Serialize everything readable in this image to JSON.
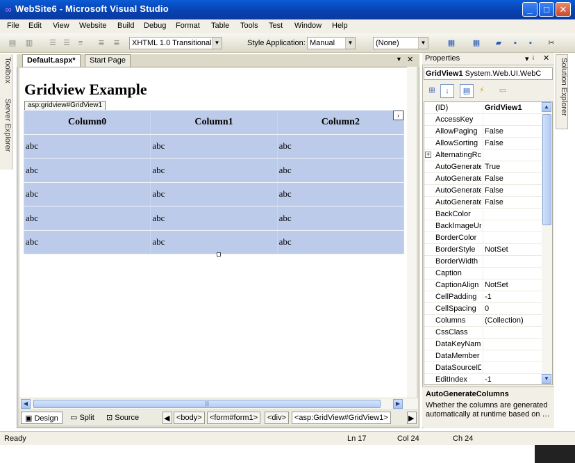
{
  "window": {
    "title": "WebSite6 - Microsoft Visual Studio",
    "minimize": "_",
    "maximize": "□",
    "close": "✕"
  },
  "menu": [
    "File",
    "Edit",
    "View",
    "Website",
    "Build",
    "Debug",
    "Format",
    "Table",
    "Tools",
    "Test",
    "Window",
    "Help"
  ],
  "toolbar": {
    "doctype_value": "XHTML 1.0 Transitional (",
    "style_application_label": "Style Application:",
    "style_application_value": "Manual",
    "target_rule_value": "(None)"
  },
  "left_dock": {
    "toolbox": "Toolbox",
    "server_explorer": "Server Explorer"
  },
  "right_dock": {
    "solution_explorer": "Solution Explorer"
  },
  "tabs": [
    {
      "label": "Default.aspx*",
      "active": true
    },
    {
      "label": "Start Page",
      "active": false
    }
  ],
  "design": {
    "heading": "Gridview Example",
    "gridview_tag": "asp:gridview#GridView1",
    "smart_tag": "›",
    "columns": [
      "Column0",
      "Column1",
      "Column2"
    ],
    "rows": [
      [
        "abc",
        "abc",
        "abc"
      ],
      [
        "abc",
        "abc",
        "abc"
      ],
      [
        "abc",
        "abc",
        "abc"
      ],
      [
        "abc",
        "abc",
        "abc"
      ],
      [
        "abc",
        "abc",
        "abc"
      ]
    ]
  },
  "views": {
    "design": "Design",
    "split": "Split",
    "source": "Source"
  },
  "tag_path": [
    "<body>",
    "<form#form1>",
    "<div>",
    "<asp:GridView#GridView1>"
  ],
  "properties": {
    "title": "Properties",
    "pin": "▾ ᛍ",
    "close": "✕",
    "object_name": "GridView1",
    "object_type": "System.Web.UI.WebC",
    "rows": [
      {
        "name": "(ID)",
        "value": "GridView1",
        "bold": true
      },
      {
        "name": "AccessKey",
        "value": ""
      },
      {
        "name": "AllowPaging",
        "value": "False"
      },
      {
        "name": "AllowSorting",
        "value": "False"
      },
      {
        "name": "AlternatingRc",
        "value": "",
        "expandable": true
      },
      {
        "name": "AutoGenerate",
        "value": "True"
      },
      {
        "name": "AutoGenerate",
        "value": "False"
      },
      {
        "name": "AutoGenerate",
        "value": "False"
      },
      {
        "name": "AutoGenerate",
        "value": "False"
      },
      {
        "name": "BackColor",
        "value": ""
      },
      {
        "name": "BackImageUrl",
        "value": ""
      },
      {
        "name": "BorderColor",
        "value": ""
      },
      {
        "name": "BorderStyle",
        "value": "NotSet"
      },
      {
        "name": "BorderWidth",
        "value": ""
      },
      {
        "name": "Caption",
        "value": ""
      },
      {
        "name": "CaptionAlign",
        "value": "NotSet"
      },
      {
        "name": "CellPadding",
        "value": "-1"
      },
      {
        "name": "CellSpacing",
        "value": "0"
      },
      {
        "name": "Columns",
        "value": "(Collection)"
      },
      {
        "name": "CssClass",
        "value": ""
      },
      {
        "name": "DataKeyName",
        "value": ""
      },
      {
        "name": "DataMember",
        "value": ""
      },
      {
        "name": "DataSourceID",
        "value": ""
      },
      {
        "name": "EditIndex",
        "value": "-1"
      }
    ],
    "description_title": "AutoGenerateColumns",
    "description_text": "Whether the columns are generated automatically at runtime based on …"
  },
  "status": {
    "ready": "Ready",
    "line": "Ln 17",
    "col": "Col 24",
    "ch": "Ch 24"
  },
  "colors": {
    "titlebar": "#0842b0",
    "grid_background": "#bdcbea"
  }
}
